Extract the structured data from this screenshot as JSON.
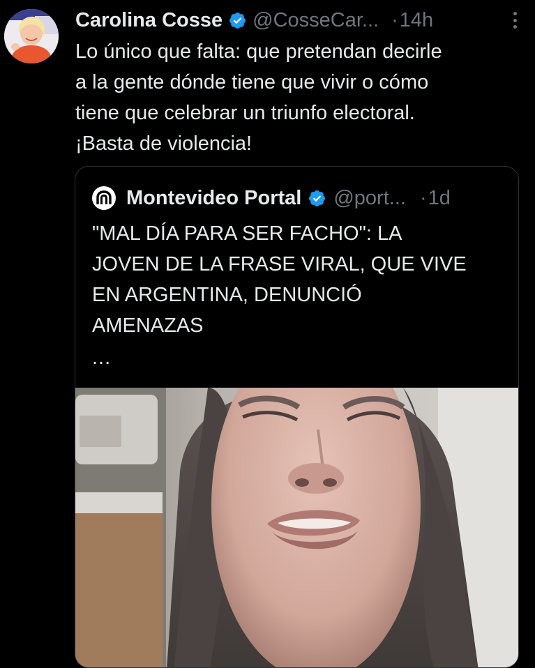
{
  "tweet": {
    "display_name": "Carolina Cosse",
    "handle": "@CosseCar...",
    "separator": "·",
    "time": "14h",
    "text": "Lo único que falta: que pretendan decirle\na la gente dónde tiene que vivir o cómo\ntiene que celebrar un triunfo electoral.\n¡Basta de violencia!",
    "verified": true
  },
  "quoted_tweet": {
    "display_name": "Montevideo Portal",
    "handle": "@port...",
    "separator": "·",
    "time": "1d",
    "text": "\"MAL DÍA PARA SER FACHO\": LA\nJOVEN DE LA FRASE VIRAL, QUE VIVE\nEN ARGENTINA, DENUNCIÓ\nAMENAZAS",
    "ellipsis": "...",
    "verified": true
  },
  "icons": {
    "verified": "verified-badge-icon",
    "more": "more-options-icon",
    "portal_logo": "montevideo-portal-logo-icon"
  },
  "colors": {
    "background": "#000000",
    "text_primary": "#e7e9ea",
    "text_secondary": "#71767b",
    "verified_blue": "#1d9bf0",
    "border": "#2f3336"
  }
}
